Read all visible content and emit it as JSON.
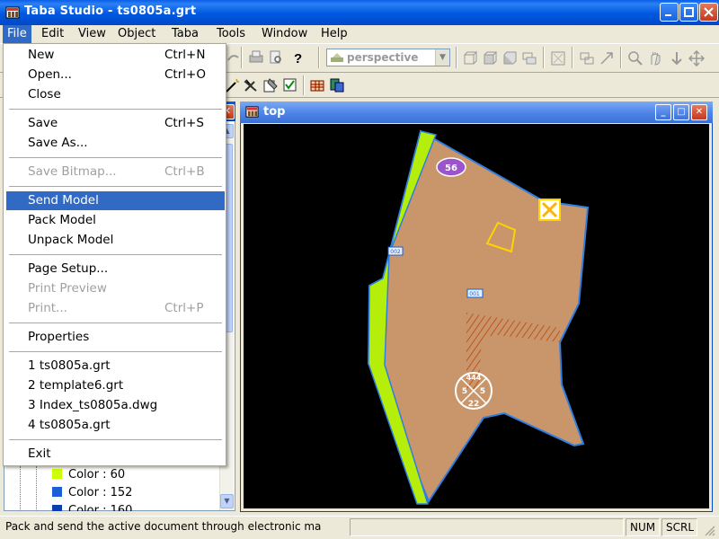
{
  "window": {
    "title": "Taba Studio - ts0805a.grt"
  },
  "menubar": [
    "File",
    "Edit",
    "View",
    "Object",
    "Taba",
    "Tools",
    "Window",
    "Help"
  ],
  "toolbar": {
    "view_combo_value": "perspective"
  },
  "file_menu": {
    "items": [
      {
        "label": "New",
        "shortcut": "Ctrl+N"
      },
      {
        "label": "Open...",
        "shortcut": "Ctrl+O"
      },
      {
        "label": "Close",
        "shortcut": ""
      },
      {
        "label": "Save",
        "shortcut": "Ctrl+S"
      },
      {
        "label": "Save As...",
        "shortcut": ""
      },
      {
        "label": "Save Bitmap...",
        "shortcut": "Ctrl+B",
        "disabled": true
      },
      {
        "label": "Send Model",
        "shortcut": "",
        "highlighted": true
      },
      {
        "label": "Pack Model",
        "shortcut": ""
      },
      {
        "label": "Unpack Model",
        "shortcut": ""
      },
      {
        "label": "Page Setup...",
        "shortcut": ""
      },
      {
        "label": "Print Preview",
        "shortcut": "",
        "disabled": true
      },
      {
        "label": "Print...",
        "shortcut": "Ctrl+P",
        "disabled": true
      },
      {
        "label": "Properties",
        "shortcut": ""
      },
      {
        "label": "1 ts0805a.grt",
        "shortcut": ""
      },
      {
        "label": "2 template6.grt",
        "shortcut": ""
      },
      {
        "label": "3 Index_ts0805a.dwg",
        "shortcut": ""
      },
      {
        "label": "4 ts0805a.grt",
        "shortcut": ""
      },
      {
        "label": "Exit",
        "shortcut": ""
      }
    ]
  },
  "tree": {
    "items": [
      {
        "label": "Color : 60",
        "color": "#ccff00"
      },
      {
        "label": "Color : 152",
        "color": "#1a5fd6"
      },
      {
        "label": "Color : 160",
        "color": "#0b3fb0"
      }
    ]
  },
  "document": {
    "title": "top",
    "labels": {
      "badge_56": "56",
      "tag_002": "002",
      "tag_001": "001",
      "compass_top": "444",
      "compass_left": "5",
      "compass_right": "5",
      "compass_bottom": "22"
    },
    "colors": {
      "parcel_fill": "#c8966a",
      "parcel_border": "#2f7fe0",
      "strip": "#b4ee0a",
      "badge": "#9a55cc",
      "marker": "#ffd200",
      "hatch": "#c0541e",
      "background": "#000000"
    }
  },
  "statusbar": {
    "message": "Pack and send the active document through electronic ma",
    "num": "NUM",
    "scrl": "SCRL"
  }
}
